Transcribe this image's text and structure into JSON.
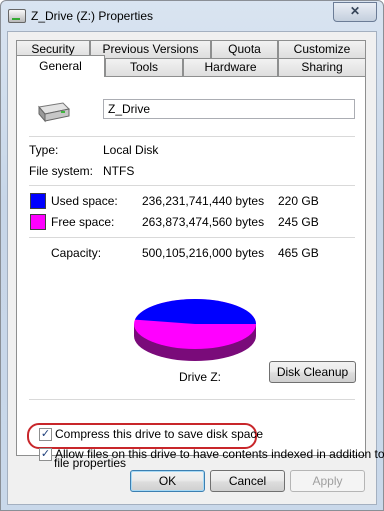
{
  "window": {
    "title": "Z_Drive (Z:) Properties",
    "close_label": "✕"
  },
  "tabs_row1": [
    "Security",
    "Previous Versions",
    "Quota",
    "Customize"
  ],
  "tabs_row2": [
    "General",
    "Tools",
    "Hardware",
    "Sharing"
  ],
  "active_tab": "General",
  "general": {
    "drive_name": "Z_Drive",
    "type_label": "Type:",
    "type_value": "Local Disk",
    "fs_label": "File system:",
    "fs_value": "NTFS",
    "used": {
      "label": "Used space:",
      "bytes": "236,231,741,440 bytes",
      "size": "220 GB",
      "color": "#0000ff"
    },
    "free": {
      "label": "Free space:",
      "bytes": "263,873,474,560 bytes",
      "size": "245 GB",
      "color": "#ff00ff"
    },
    "capacity": {
      "label": "Capacity:",
      "bytes": "500,105,216,000 bytes",
      "size": "465 GB"
    },
    "pie_used_fraction": 0.472,
    "drive_label": "Drive Z:",
    "cleanup_label": "Disk Cleanup",
    "compress_label": "Compress this drive to save disk space",
    "compress_checked": true,
    "index_label_line1": "Allow files on this drive to have contents indexed in addition to",
    "index_label_line2": "file properties",
    "index_checked": true
  },
  "buttons": {
    "ok": "OK",
    "cancel": "Cancel",
    "apply": "Apply"
  }
}
